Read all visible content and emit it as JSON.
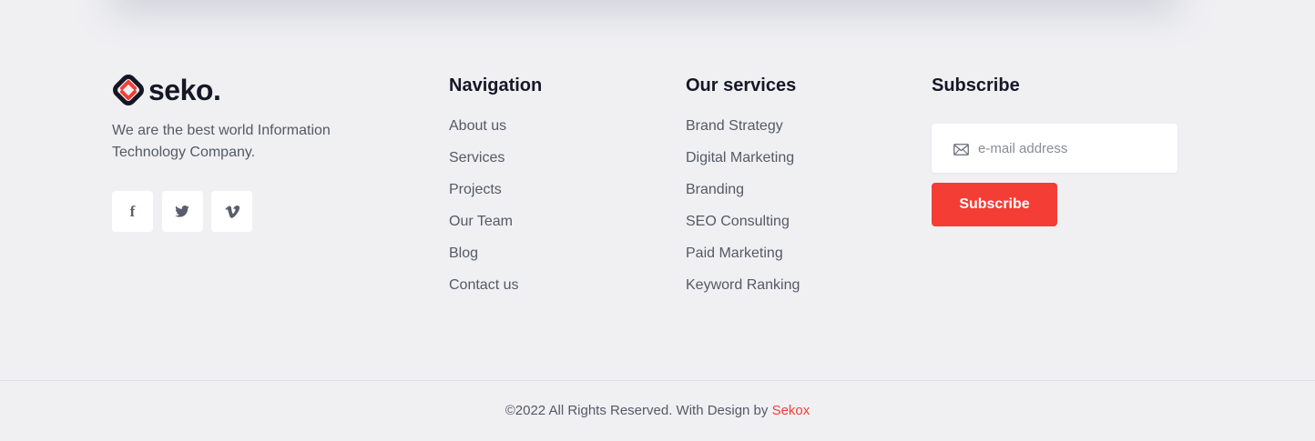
{
  "brand": {
    "logo_text": "seko.",
    "tagline": "We are the best world Information Technology Company.",
    "colors": {
      "accent": "#f33d35",
      "dark": "#151726"
    }
  },
  "socials": [
    {
      "icon": "facebook-icon",
      "glyph": "f"
    },
    {
      "icon": "twitter-icon",
      "glyph": "🐦"
    },
    {
      "icon": "vimeo-icon",
      "glyph": "v"
    }
  ],
  "navigation": {
    "title": "Navigation",
    "items": [
      "About us",
      "Services",
      "Projects",
      "Our Team",
      "Blog",
      "Contact us"
    ]
  },
  "services": {
    "title": "Our services",
    "items": [
      "Brand Strategy",
      "Digital Marketing",
      "Branding",
      "SEO Consulting",
      "Paid Marketing",
      "Keyword Ranking"
    ]
  },
  "subscribe": {
    "title": "Subscribe",
    "placeholder": "e-mail address",
    "button_label": "Subscribe"
  },
  "footer": {
    "copyright_text": "©2022 All Rights Reserved. With Design by ",
    "designer_link": "Sekox"
  }
}
